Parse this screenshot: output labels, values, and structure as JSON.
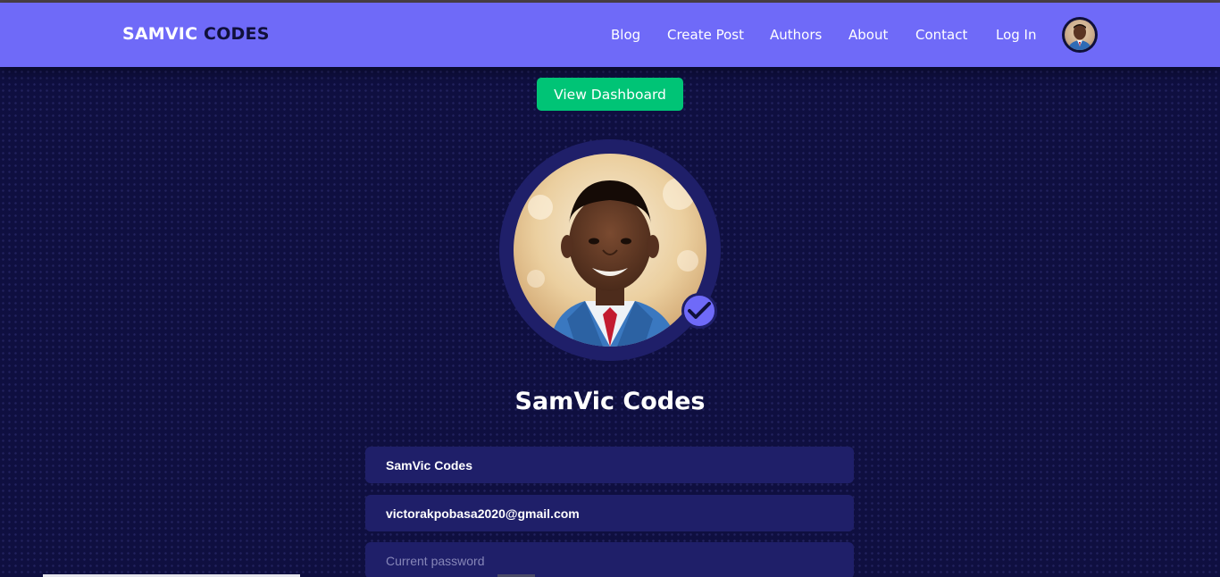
{
  "brand": {
    "part1": "SAMVIC",
    "part2": "CODES"
  },
  "nav": {
    "links": [
      "Blog",
      "Create Post",
      "Authors",
      "About",
      "Contact",
      "Log In"
    ]
  },
  "dashboard_button": "View Dashboard",
  "profile": {
    "name": "SamVic Codes",
    "verified": true
  },
  "form": {
    "full_name_value": "SamVic Codes",
    "email_value": "victorakpobasa2020@gmail.com",
    "current_password_placeholder": "Current password"
  },
  "colors": {
    "navbar": "#6f6af8",
    "background": "#0f0f40",
    "field": "#1f1f69",
    "accent_green": "#00c476"
  }
}
